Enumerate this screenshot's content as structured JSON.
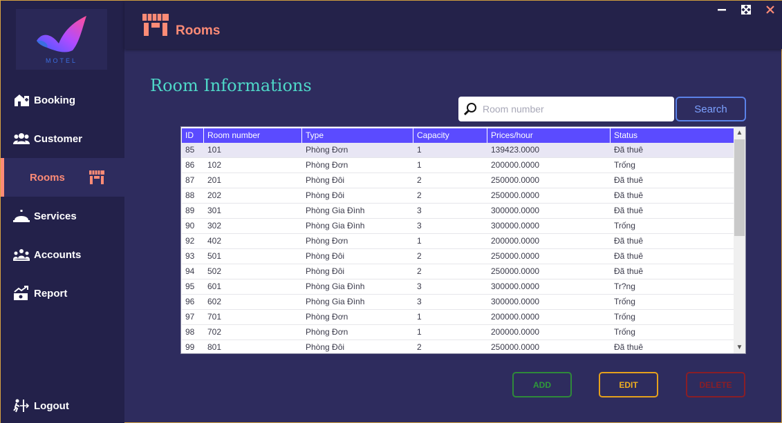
{
  "app": {
    "logo_text": "MOTEL",
    "header_title": "Rooms",
    "window_controls": {
      "minimize": "minus-icon",
      "maximize": "maximize-icon",
      "close": "close-icon"
    }
  },
  "sidebar": {
    "items": [
      {
        "label": "Booking",
        "icon": "hotel-icon"
      },
      {
        "label": "Customer",
        "icon": "users-icon"
      },
      {
        "label": "Rooms",
        "icon": "store-icon",
        "active": true
      },
      {
        "label": "Services",
        "icon": "bell-icon"
      },
      {
        "label": "Accounts",
        "icon": "group-icon"
      },
      {
        "label": "Report",
        "icon": "chart-money-icon"
      }
    ],
    "logout_label": "Logout"
  },
  "main": {
    "title": "Room Informations",
    "search": {
      "placeholder": "Room number",
      "value": "",
      "button_label": "Search"
    },
    "table": {
      "columns": [
        "ID",
        "Room number",
        "Type",
        "Capacity",
        "Prices/hour",
        "Status"
      ],
      "rows": [
        [
          "85",
          "101",
          "Phòng Đơn",
          "1",
          "139423.0000",
          "Đã thuê"
        ],
        [
          "86",
          "102",
          "Phòng Đơn",
          "1",
          "200000.0000",
          "Trống"
        ],
        [
          "87",
          "201",
          "Phòng Đôi",
          "2",
          "250000.0000",
          "Đã thuê"
        ],
        [
          "88",
          "202",
          "Phòng Đôi",
          "2",
          "250000.0000",
          "Đã thuê"
        ],
        [
          "89",
          "301",
          "Phòng Gia Đình",
          "3",
          "300000.0000",
          "Đã thuê"
        ],
        [
          "90",
          "302",
          "Phòng Gia Đình",
          "3",
          "300000.0000",
          "Trống"
        ],
        [
          "92",
          "402",
          "Phòng Đơn",
          "1",
          "200000.0000",
          "Đã thuê"
        ],
        [
          "93",
          "501",
          "Phòng Đôi",
          "2",
          "250000.0000",
          "Đã thuê"
        ],
        [
          "94",
          "502",
          "Phòng Đôi",
          "2",
          "250000.0000",
          "Đã thuê"
        ],
        [
          "95",
          "601",
          "Phòng Gia Đình",
          "3",
          "300000.0000",
          "Tr?ng"
        ],
        [
          "96",
          "602",
          "Phòng Gia Đình",
          "3",
          "300000.0000",
          "Trống"
        ],
        [
          "97",
          "701",
          "Phòng Đơn",
          "1",
          "200000.0000",
          "Trống"
        ],
        [
          "98",
          "702",
          "Phòng Đơn",
          "1",
          "200000.0000",
          "Trống"
        ],
        [
          "99",
          "801",
          "Phòng Đôi",
          "2",
          "250000.0000",
          "Đã thuê"
        ]
      ],
      "selected_row": 0
    },
    "actions": {
      "add": "ADD",
      "edit": "EDIT",
      "delete": "DELETE"
    }
  },
  "colors": {
    "accent": "#fd8b76",
    "title": "#4fd8c8",
    "header_bg": "#5b4bff",
    "sidebar_bg": "#23214a",
    "main_bg": "#2e2c5e"
  }
}
